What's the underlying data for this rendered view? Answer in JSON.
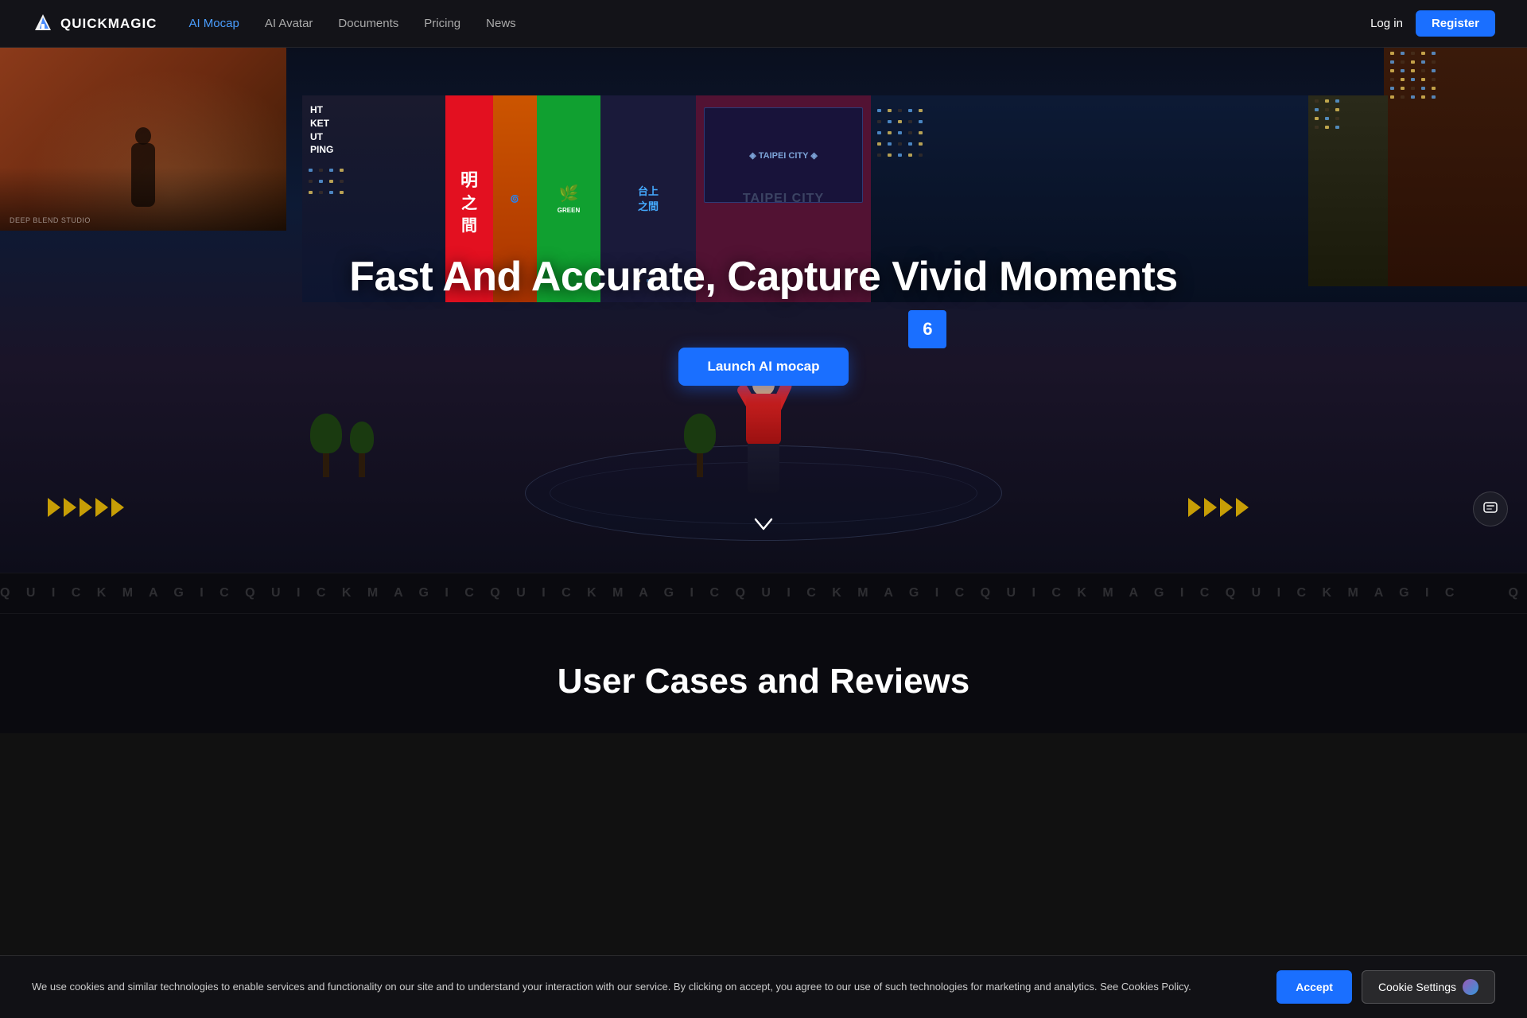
{
  "brand": {
    "name": "QUICKMAGIC",
    "logo_alt": "QuickMagic logo"
  },
  "navbar": {
    "links": [
      {
        "id": "ai-mocap",
        "label": "AI Mocap",
        "active": true
      },
      {
        "id": "ai-avatar",
        "label": "AI Avatar",
        "active": false
      },
      {
        "id": "documents",
        "label": "Documents",
        "active": false
      },
      {
        "id": "pricing",
        "label": "Pricing",
        "active": false
      },
      {
        "id": "news",
        "label": "News",
        "active": false
      }
    ],
    "login_label": "Log in",
    "register_label": "Register"
  },
  "hero": {
    "title": "Fast And Accurate, Capture Vivid Moments",
    "cta_label": "Launch AI mocap",
    "number_sign": "6",
    "watermark": "DEEP BLEND STUDIO"
  },
  "ticker": {
    "text": "Q U I C K M A G I C   Q U I C K M A G I C   Q U I C K M A G I C   Q U I C K M A G I C   Q U I C K M A G I C   Q U I C K M A G I C"
  },
  "section_reviews": {
    "title": "User Cases and Reviews"
  },
  "cookie": {
    "text": "We use cookies and similar technologies to enable services and functionality on our site and to understand your interaction with our service. By clicking on accept, you agree to our use of such technologies for marketing and analytics. See Cookies Policy.",
    "accept_label": "Accept",
    "settings_label": "Cookie Settings"
  },
  "billboards": [
    {
      "id": "bb1",
      "text": "HT\nKET\nUT\nPING"
    },
    {
      "id": "bb2",
      "text": ""
    },
    {
      "id": "bb3",
      "text": ""
    },
    {
      "id": "bb4",
      "text": "台上\n之間"
    },
    {
      "id": "bb5",
      "text": "TAIPEI CITY"
    },
    {
      "id": "bb6",
      "text": ""
    }
  ],
  "colors": {
    "accent": "#1a6fff",
    "accent_hover": "#1a5de0",
    "text_primary": "#ffffff",
    "text_muted": "#aaaaaa",
    "bg_dark": "#0a0a0f",
    "navbar_bg": "rgba(20,20,25,0.95)"
  }
}
